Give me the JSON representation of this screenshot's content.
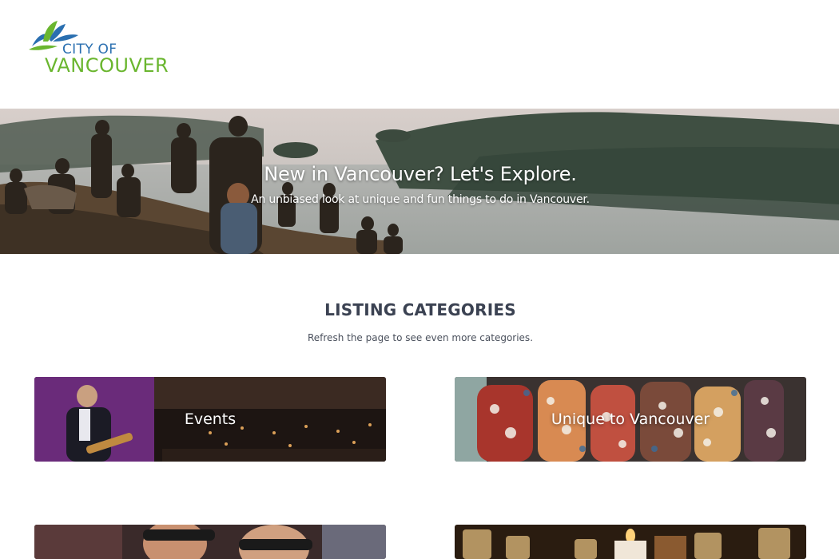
{
  "logo": {
    "line1": "CITY OF",
    "line2": "VANCOUVER"
  },
  "hero": {
    "title": "New in Vancouver? Let's Explore.",
    "subtitle": "An unbiased look at unique and fun things to do in Vancouver."
  },
  "section": {
    "title": "LISTING CATEGORIES",
    "subtitle": "Refresh the page to see even more categories."
  },
  "categories": [
    {
      "label": "Events"
    },
    {
      "label": "Unique to Vancouver"
    },
    {
      "label": ""
    },
    {
      "label": ""
    }
  ],
  "colors": {
    "brand_blue": "#2a6fb0",
    "brand_green": "#6ab62f",
    "heading": "#3b4252"
  }
}
